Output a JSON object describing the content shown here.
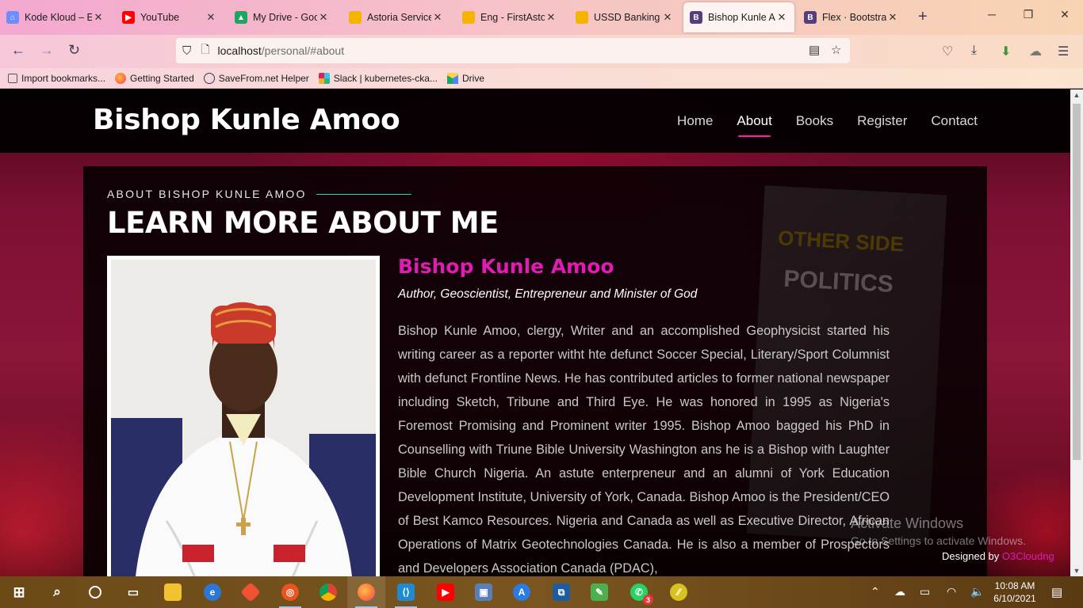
{
  "browser": {
    "tabs": [
      {
        "title": "Kode Kloud – Ex",
        "icon": "kodekloud-icon",
        "color": "#6c8cff",
        "active": false
      },
      {
        "title": "YouTube",
        "icon": "youtube-icon",
        "color": "#ff0000",
        "active": false
      },
      {
        "title": "My Drive - Goog",
        "icon": "google-drive-icon",
        "color": "#1fa463",
        "active": false
      },
      {
        "title": "Astoria Services",
        "icon": "slides-icon",
        "color": "#f4b400",
        "active": false
      },
      {
        "title": "Eng - FirstAstori",
        "icon": "slides-icon",
        "color": "#f4b400",
        "active": false
      },
      {
        "title": "USSD Banking -",
        "icon": "slides-icon",
        "color": "#f4b400",
        "active": false
      },
      {
        "title": "Bishop Kunle Am",
        "icon": "bootstrap-icon",
        "color": "#563d7c",
        "active": true
      },
      {
        "title": "Flex · Bootstrap",
        "icon": "bootstrap-icon",
        "color": "#563d7c",
        "active": false
      }
    ],
    "url_host": "localhost",
    "url_path": "/personal/#about",
    "bookmarks": [
      {
        "label": "Import bookmarks...",
        "icon": "import-icon",
        "color": "#555555"
      },
      {
        "label": "Getting Started",
        "icon": "firefox-icon",
        "color": "#ff7139"
      },
      {
        "label": "SaveFrom.net Helper",
        "icon": "globe-icon",
        "color": "#3a3a55"
      },
      {
        "label": "Slack | kubernetes-cka...",
        "icon": "slack-icon",
        "color": "#4a154b"
      },
      {
        "label": "Drive",
        "icon": "google-drive-icon",
        "color": "#1fa463"
      }
    ]
  },
  "site": {
    "logo": "Bishop Kunle Amoo",
    "menu": [
      {
        "label": "Home",
        "active": false
      },
      {
        "label": "About",
        "active": true
      },
      {
        "label": "Books",
        "active": false
      },
      {
        "label": "Register",
        "active": false
      },
      {
        "label": "Contact",
        "active": false
      }
    ],
    "kicker": "ABOUT BISHOP KUNLE AMOO",
    "section_title": "LEARN MORE ABOUT ME",
    "bio_name": "Bishop Kunle Amoo",
    "bio_role": "Author, Geoscientist, Entrepreneur and Minister of God",
    "bio_text": "Bishop Kunle Amoo, clergy, Writer and an accomplished Geophysicist started his writing career as a reporter witht hte defunct Soccer Special, Literary/Sport Columnist with defunct Frontline News. He has contributed articles to former national newspaper including Sketch, Tribune and Third Eye. He was honored in 1995 as Nigeria's Foremost Promising and Prominent writer 1995. Bishop Amoo bagged his PhD in Counselling with Triune Bible University Washington ans he is a Bishop with Laughter Bible Church Nigeria. An astute enterpreneur and an alumni of York Education Development Institute, University of York, Canada. Bishop Amoo is the President/CEO of Best Kamco Resources. Nigeria and Canada as well as Executive Director, African Operations of Matrix Geotechnologies Canada. He is also a member of Prospectors and Developers Association Canada (PDAC),",
    "credit_prefix": "Designed by",
    "credit_name": "O3Cloudng",
    "accent": "#e21bb5"
  },
  "watermark": {
    "line1": "Activate Windows",
    "line2": "Go to Settings to activate Windows."
  },
  "taskbar": {
    "time": "10:08 AM",
    "date": "6/10/2021",
    "whatsapp_badge": "3"
  }
}
